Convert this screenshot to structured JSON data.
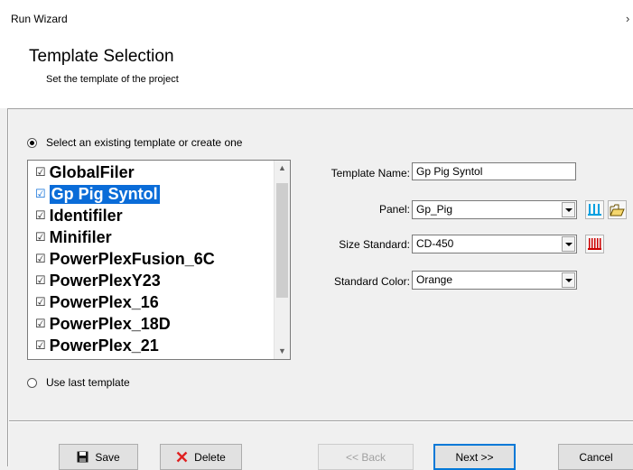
{
  "window": {
    "title": "Run Wizard",
    "close_glyph": "›"
  },
  "header": {
    "title": "Template Selection",
    "subtitle": "Set the template of the project"
  },
  "options": {
    "existing_label": "Select an existing template or create one",
    "existing_checked": true,
    "last_label": "Use last template",
    "last_checked": false
  },
  "templates": {
    "items": [
      {
        "label": "GlobalFiler",
        "selected": false
      },
      {
        "label": "Gp Pig Syntol",
        "selected": true
      },
      {
        "label": "Identifiler",
        "selected": false
      },
      {
        "label": "Minifiler",
        "selected": false
      },
      {
        "label": "PowerPlexFusion_6C",
        "selected": false
      },
      {
        "label": "PowerPlexY23",
        "selected": false
      },
      {
        "label": "PowerPlex_16",
        "selected": false
      },
      {
        "label": "PowerPlex_18D",
        "selected": false
      },
      {
        "label": "PowerPlex_21",
        "selected": false
      }
    ],
    "check_glyph": "☑",
    "scroll_up_glyph": "▲",
    "scroll_down_glyph": "▼"
  },
  "form": {
    "template_name_label": "Template Name:",
    "template_name_value": "Gp Pig Syntol",
    "panel_label": "Panel:",
    "panel_value": "Gp_Pig",
    "size_standard_label": "Size Standard:",
    "size_standard_value": "CD-450",
    "standard_color_label": "Standard Color:",
    "standard_color_value": "Orange"
  },
  "icons": {
    "panel_view": "panel-view-icon",
    "open_folder": "open-folder-icon",
    "size_standard_view": "size-standard-view-icon"
  },
  "buttons": {
    "save": "Save",
    "delete": "Delete",
    "back": "<< Back",
    "next": "Next >>",
    "cancel": "Cancel"
  },
  "colors": {
    "selection": "#0a6cd8",
    "panel_icon": "#00a0e0",
    "size_icon": "#cc0000",
    "delete_icon": "#e02020"
  }
}
